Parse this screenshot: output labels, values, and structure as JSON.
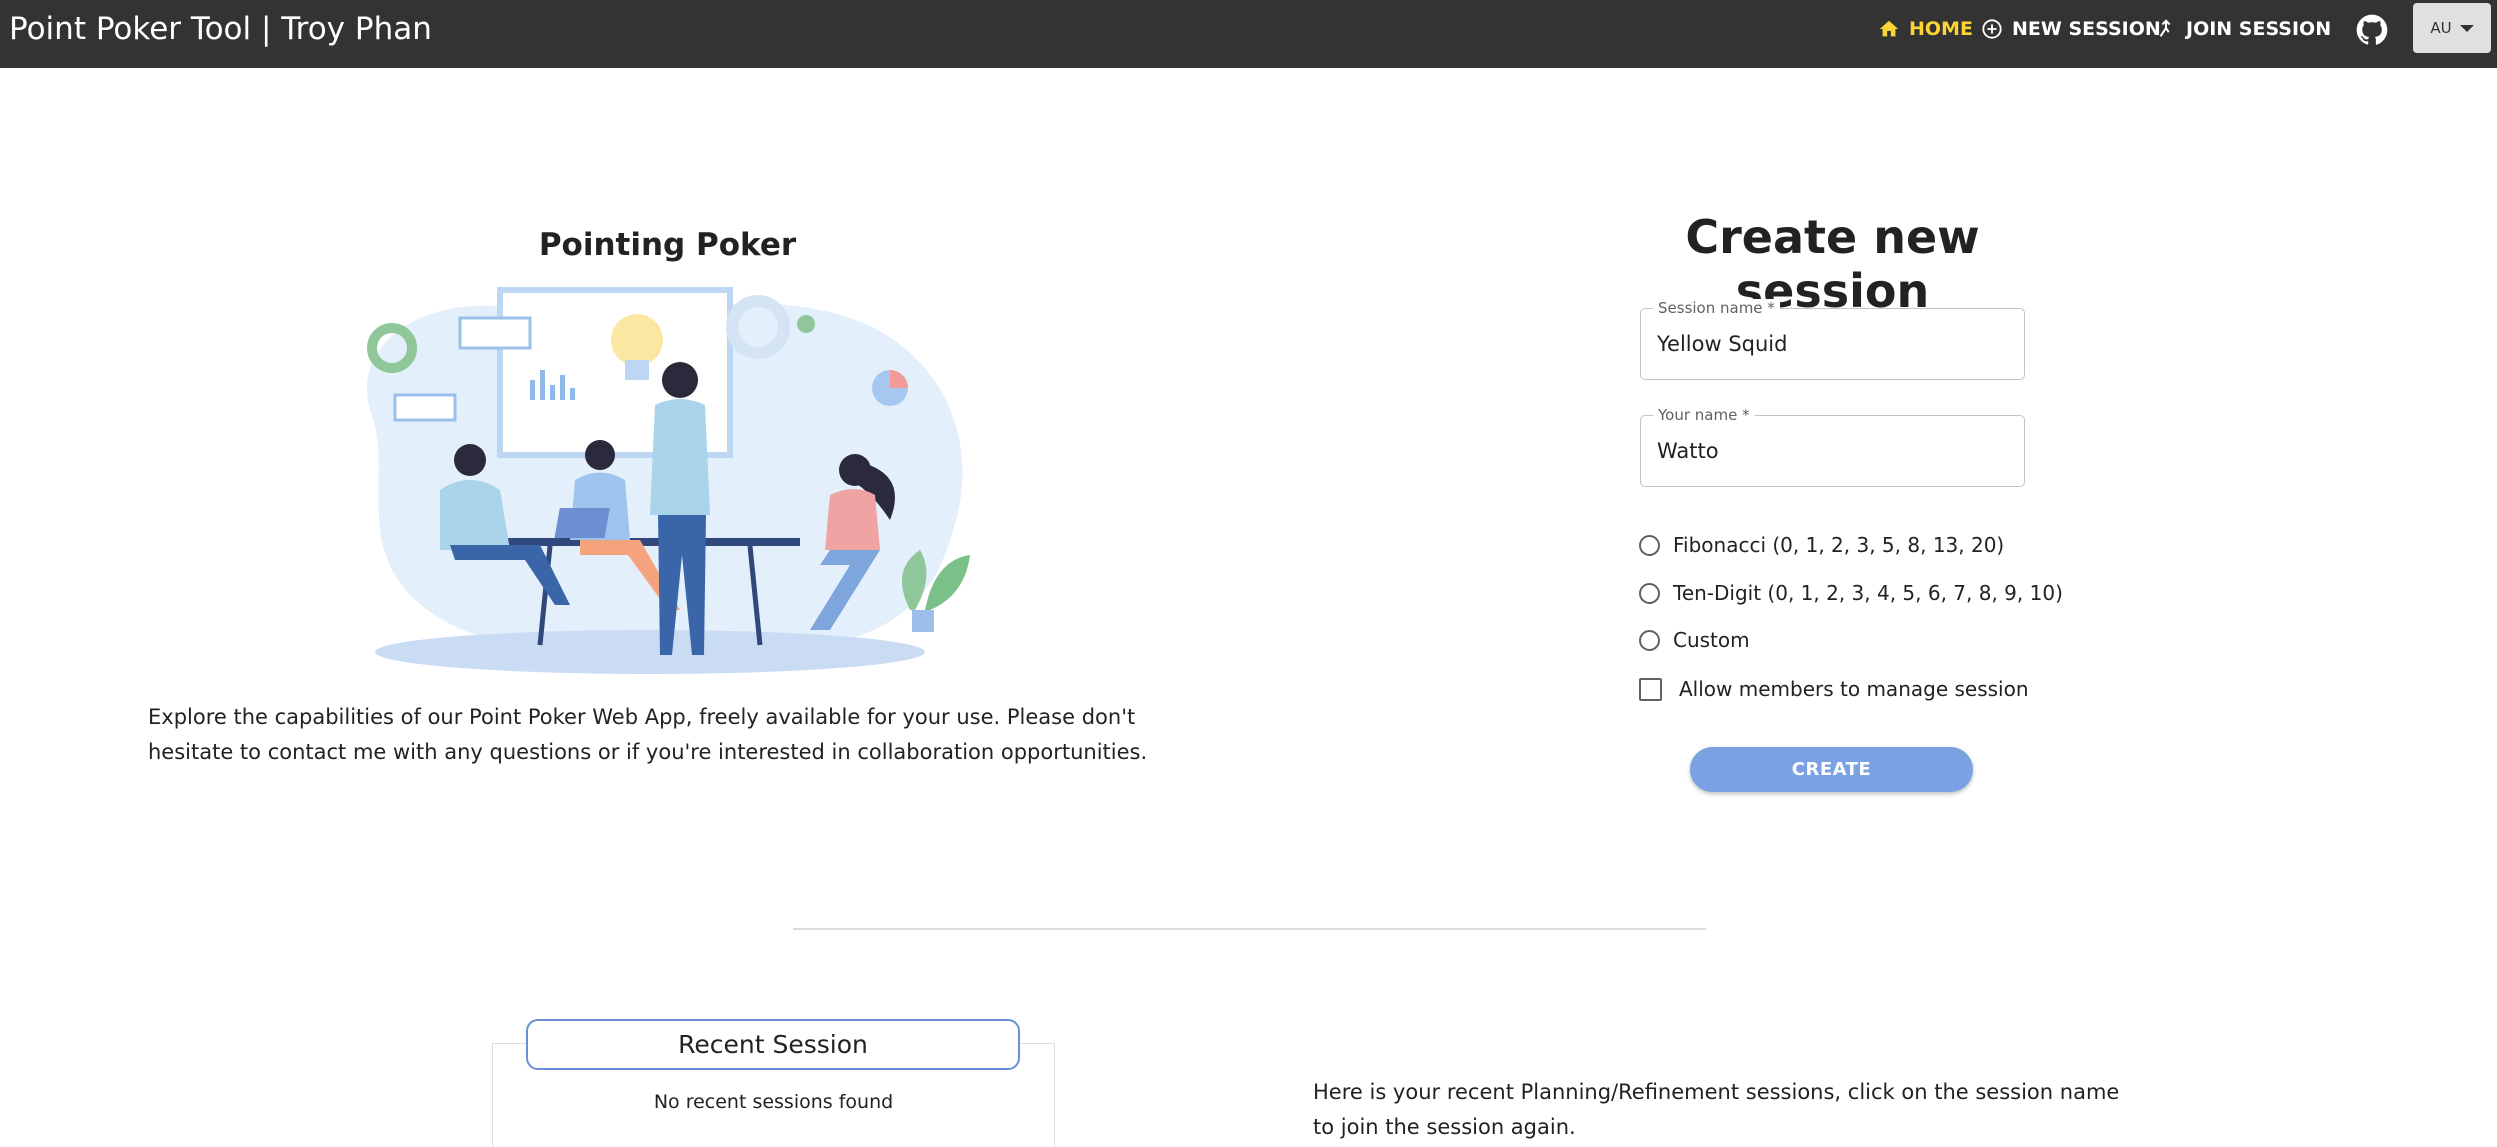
{
  "header": {
    "title": "Point Poker Tool | Troy Phan",
    "nav": {
      "home": "HOME",
      "new_session": "NEW SESSION",
      "join_session": "JOIN SESSION"
    },
    "language": "AU",
    "colors": {
      "bar": "#333333",
      "active": "#fcd534"
    }
  },
  "hero": {
    "title": "Pointing Poker",
    "description": "Explore the capabilities of our Point Poker Web App, freely available for your use. Please don't hesitate to contact me with any questions or if you're interested in collaboration opportunities."
  },
  "form": {
    "title": "Create new session",
    "session_name_label": "Session name *",
    "session_name_value": "Yellow Squid",
    "your_name_label": "Your name *",
    "your_name_value": "Watto",
    "options": {
      "fibonacci": "Fibonacci (0, 1, 2, 3, 5, 8, 13, 20)",
      "ten_digit": "Ten-Digit (0, 1, 2, 3, 4, 5, 6, 7, 8, 9, 10)",
      "custom": "Custom"
    },
    "allow_manage": "Allow members to manage session",
    "create_label": "CREATE",
    "create_color": "#7aa2e3"
  },
  "recent": {
    "title": "Recent Session",
    "empty": "No recent sessions found",
    "description": "Here is your recent Planning/Refinement sessions, click on the session name to join the session again."
  }
}
